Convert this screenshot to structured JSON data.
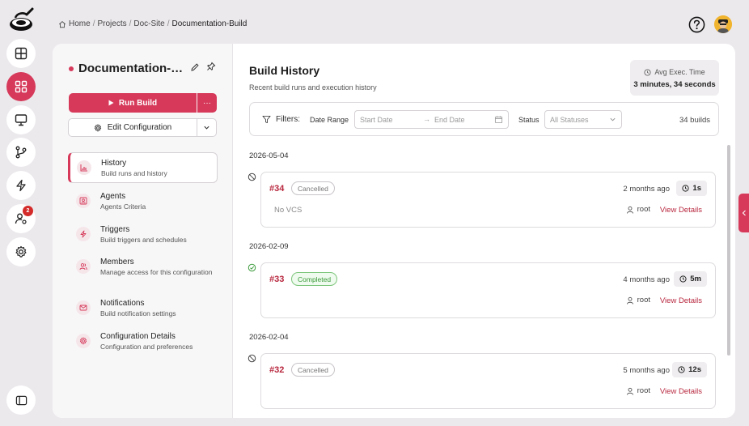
{
  "breadcrumb": {
    "home": "Home",
    "projects": "Projects",
    "project": "Doc-Site",
    "current": "Documentation-Build",
    "separator": "/"
  },
  "rail": {
    "logo": "pan-logo",
    "items": [
      "dashboard-icon",
      "apps-icon",
      "monitor-icon",
      "git-branch-icon",
      "lightning-icon",
      "user-settings-icon",
      "gear-icon"
    ],
    "active_index": 1,
    "badge": "2",
    "bottom": "sidebar-toggle-icon"
  },
  "project": {
    "title": "Documentation-Build",
    "status_color": "#d6395a"
  },
  "actions": {
    "run": "Run Build",
    "more": "···",
    "edit": "Edit Configuration"
  },
  "nav": [
    {
      "label": "History",
      "sub": "Build runs and history",
      "icon": "chart-icon",
      "active": true
    },
    {
      "label": "Agents",
      "sub": "Agents Criteria",
      "icon": "agent-icon"
    },
    {
      "label": "Triggers",
      "sub": "Build triggers and schedules",
      "icon": "lightning-icon"
    },
    {
      "label": "Members",
      "sub": "Manage access for this configuration",
      "icon": "members-icon"
    },
    {
      "label": "Notifications",
      "sub": "Build notification settings",
      "icon": "mail-icon"
    },
    {
      "label": "Configuration Details",
      "sub": "Configuration and preferences",
      "icon": "gear-icon"
    }
  ],
  "history": {
    "title": "Build History",
    "subtitle": "Recent build runs and execution history",
    "avg_label": "Avg Exec. Time",
    "avg_value": "3 minutes, 34 seconds"
  },
  "filters": {
    "label": "Filters:",
    "date_range_label": "Date Range",
    "start_placeholder": "Start Date",
    "arrow": "→",
    "end_placeholder": "End Date",
    "status_label": "Status",
    "status_value": "All Statuses",
    "count": "34 builds"
  },
  "builds": [
    {
      "date": "2026-05-04",
      "id": "#34",
      "status": "Cancelled",
      "ago": "2 months ago",
      "duration": "1s",
      "vcs": "No VCS",
      "user": "root",
      "details": "View Details"
    },
    {
      "date": "2026-02-09",
      "id": "#33",
      "status": "Completed",
      "ago": "4 months ago",
      "duration": "5m",
      "vcs": "",
      "user": "root",
      "details": "View Details"
    },
    {
      "date": "2026-02-04",
      "id": "#32",
      "status": "Cancelled",
      "ago": "5 months ago",
      "duration": "12s",
      "vcs": "",
      "user": "root",
      "details": "View Details"
    }
  ],
  "colors": {
    "accent": "#d6395a",
    "link": "#b8283f",
    "completed": "#3a9a3a"
  }
}
